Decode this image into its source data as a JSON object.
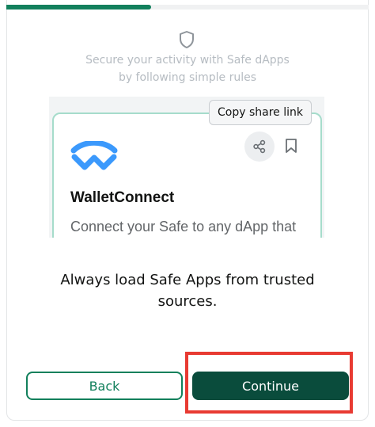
{
  "progress": {
    "value_fraction": 0.4
  },
  "header": {
    "icon": "shield-icon",
    "subtitle_line1": "Secure your activity with Safe dApps",
    "subtitle_line2": "by following simple rules"
  },
  "preview": {
    "app_name": "WalletConnect",
    "app_description": "Connect your Safe to any dApp that",
    "tooltip": "Copy share link",
    "icons": [
      "walletconnect-logo",
      "share-icon",
      "bookmark-icon"
    ]
  },
  "message": "Always load Safe Apps from trusted sources.",
  "buttons": {
    "back": "Back",
    "continue": "Continue"
  },
  "colors": {
    "accent": "#12805c",
    "primary_button": "#0a4c3c",
    "card_border": "#a6dccb",
    "highlight": "#e83a32"
  }
}
